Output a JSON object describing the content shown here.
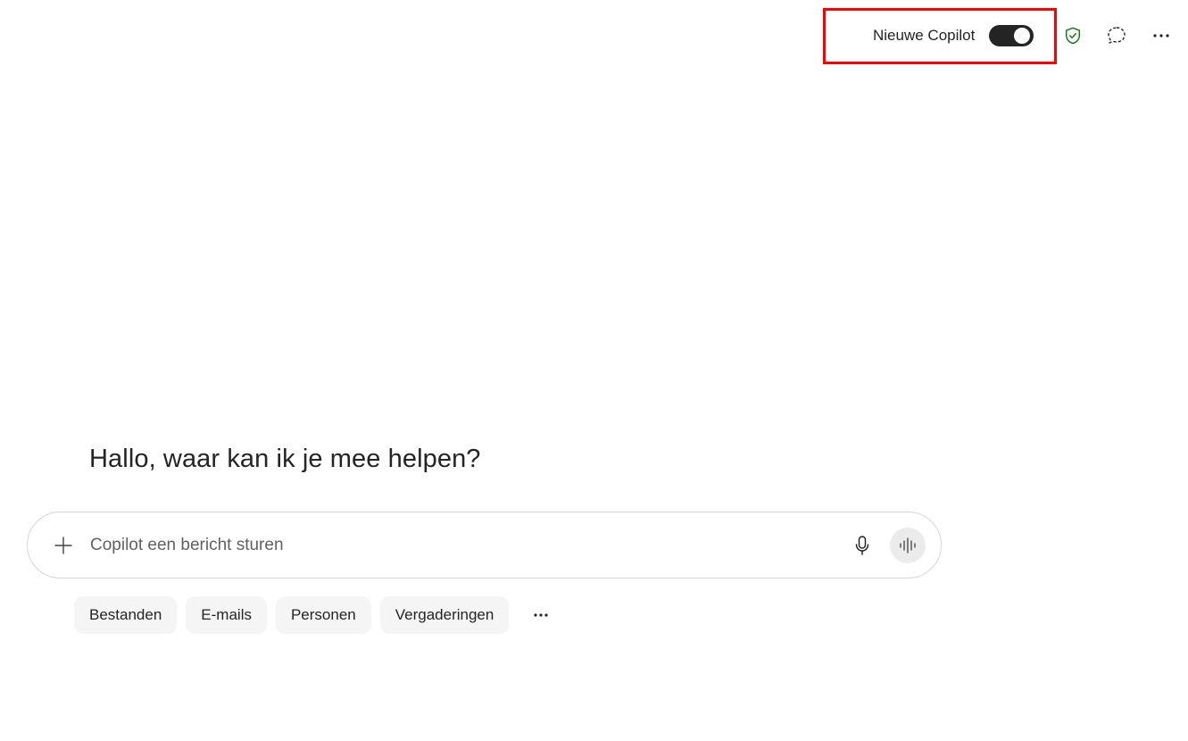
{
  "header": {
    "toggle_label": "Nieuwe Copilot",
    "toggle_state": "on",
    "icons": {
      "shield": "shield-check-icon",
      "chat": "new-chat-icon",
      "more": "more-options-icon"
    },
    "accent_colors": {
      "shield": "#107c10",
      "highlight": "#ff0000",
      "toggle_on": "#242424"
    }
  },
  "main": {
    "greeting": "Hallo, waar kan ik je mee helpen?"
  },
  "composer": {
    "placeholder": "Copilot een bericht sturen",
    "value": "",
    "icons": {
      "add": "plus-icon",
      "mic": "microphone-icon",
      "voice": "voice-waveform-icon"
    }
  },
  "chips": {
    "items": [
      {
        "label": "Bestanden"
      },
      {
        "label": "E-mails"
      },
      {
        "label": "Personen"
      },
      {
        "label": "Vergaderingen"
      }
    ],
    "more_icon": "more-horizontal-icon"
  }
}
